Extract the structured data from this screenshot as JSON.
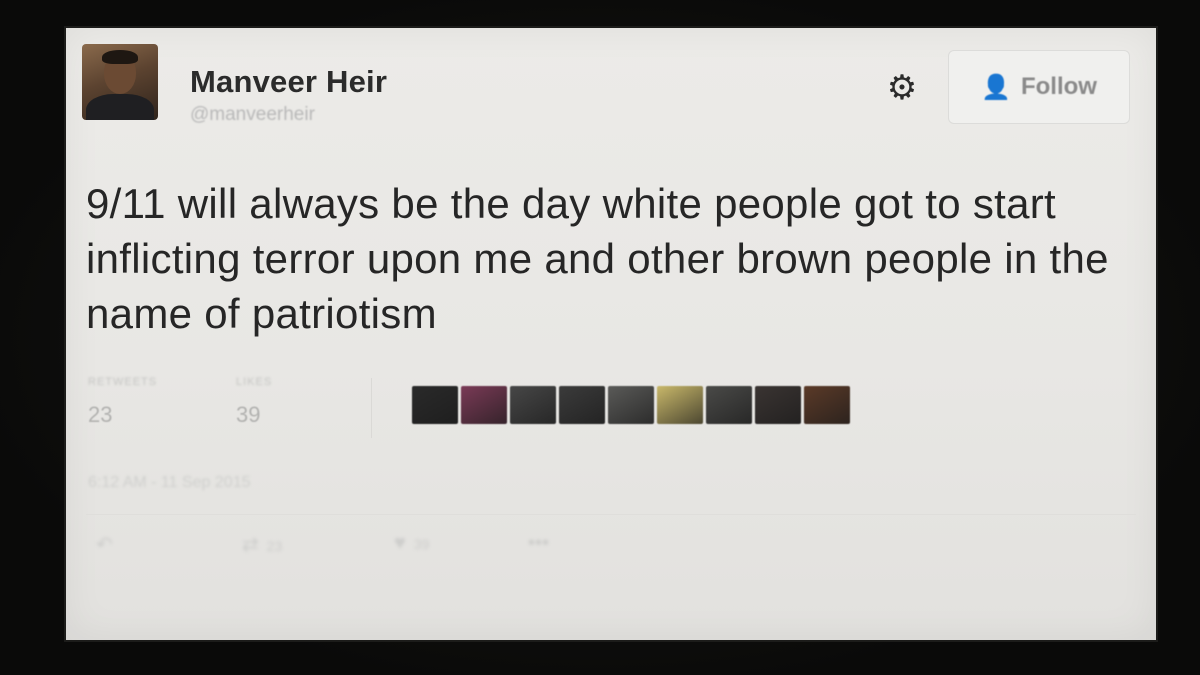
{
  "user": {
    "display_name": "Manveer Heir",
    "handle": "@manveerheir"
  },
  "header": {
    "settings_icon": "gear-icon",
    "follow_label": "Follow",
    "follow_icon": "person-add-icon",
    "follow_icon_color": "#7fa9c9"
  },
  "tweet": {
    "text": "9/11 will always be the day white people got to start inflicting terror upon me and other brown people in the name of patriotism"
  },
  "stats": {
    "retweets_label": "RETWEETS",
    "retweets_value": "23",
    "likes_label": "LIKES",
    "likes_value": "39"
  },
  "likers": [
    {
      "name": "liker-1",
      "color": "#2a2a2a"
    },
    {
      "name": "liker-2",
      "color": "#7a3a56"
    },
    {
      "name": "liker-3",
      "color": "#474747"
    },
    {
      "name": "liker-4",
      "color": "#3b3b3b"
    },
    {
      "name": "liker-5",
      "color": "#5a5a58"
    },
    {
      "name": "liker-6",
      "color": "#c9b86a"
    },
    {
      "name": "liker-7",
      "color": "#4a4a48"
    },
    {
      "name": "liker-8",
      "color": "#3a3432"
    },
    {
      "name": "liker-9",
      "color": "#5b3a28"
    }
  ],
  "meta": {
    "timestamp": "6:12 AM - 11 Sep 2015"
  },
  "actions": {
    "reply_icon": "reply-icon",
    "retweet_icon": "retweet-icon",
    "retweet_count": "23",
    "like_icon": "heart-icon",
    "like_count": "39",
    "more_icon": "more-icon"
  }
}
